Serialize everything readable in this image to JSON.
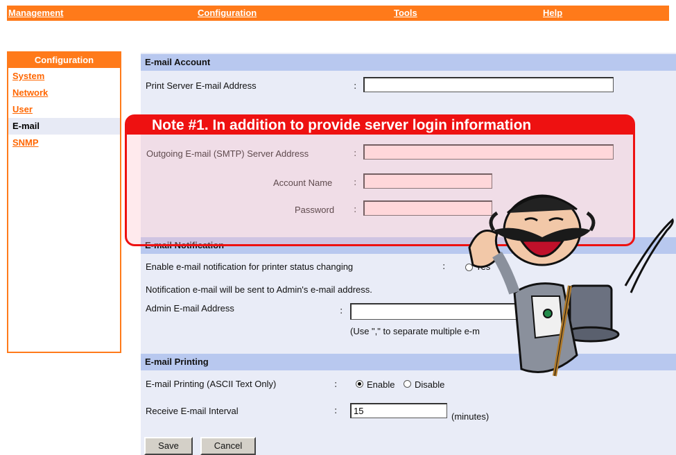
{
  "topnav": [
    "Management",
    "Configuration",
    "Tools",
    "Help"
  ],
  "sidebar": {
    "title": "Configuration",
    "items": [
      "System",
      "Network",
      "User",
      "E-mail",
      "SNMP"
    ],
    "active_index": 3
  },
  "email_account": {
    "header": "E-mail Account",
    "print_server_label": "Print Server E-mail Address",
    "print_server_value": "",
    "smtp_label": "Outgoing E-mail (SMTP) Server Address",
    "smtp_value": "",
    "account_label": "Account Name",
    "account_value": "",
    "password_label": "Password",
    "password_value": ""
  },
  "note": {
    "text": "Note #1. In addition to provide server login information"
  },
  "email_notification": {
    "header": "E-mail Notification",
    "enable_label": "Enable e-mail notification for printer status changing",
    "enable_option_yes": "Yes",
    "info_text": "Notification e-mail will be sent to Admin's e-mail address.",
    "admin_label": "Admin E-mail Address",
    "admin_value": "",
    "separator_hint": "(Use \",\" to separate multiple e-m"
  },
  "email_printing": {
    "header": "E-mail Printing",
    "printing_label": "E-mail Printing (ASCII Text Only)",
    "option_enable": "Enable",
    "option_disable": "Disable",
    "selected": "Enable",
    "interval_label": "Receive E-mail Interval",
    "interval_value": "15",
    "interval_unit": "(minutes)"
  },
  "buttons": {
    "save": "Save",
    "cancel": "Cancel"
  },
  "colors": {
    "accent": "#ff7a1a",
    "note": "#ee1111",
    "section": "#b8c8ef",
    "panel": "#e9ecf7"
  }
}
